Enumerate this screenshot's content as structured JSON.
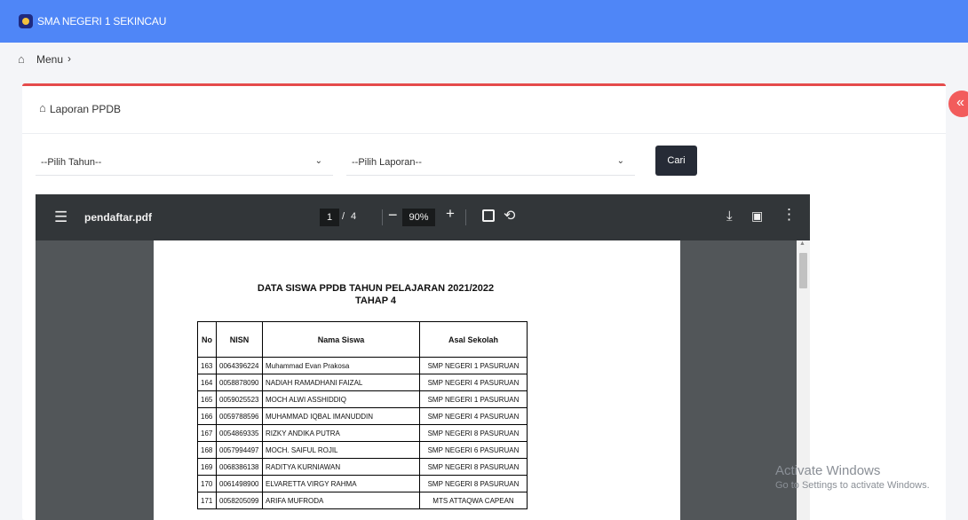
{
  "topbar": {
    "school_name": "SMA NEGERI 1 SEKINCAU"
  },
  "breadcrumb": {
    "home_icon": "home-icon",
    "menu_label": "Menu",
    "separator": "›"
  },
  "collapse_button": {
    "icon": "double-chevron-left-icon",
    "glyph": "«"
  },
  "card": {
    "title": "Laporan PPDB"
  },
  "filters": {
    "year_select": "--Pilih Tahun--",
    "report_select": "--Pilih Laporan--",
    "search_button": "Cari"
  },
  "pdf": {
    "file_name": "pendaftar.pdf",
    "current_page": "1",
    "page_separator": "/",
    "total_pages": "4",
    "zoom": "90%",
    "document": {
      "heading": "DATA SISWA PPDB TAHUN PELAJARAN 2021/2022",
      "subheading": "TAHAP 4",
      "columns": [
        "No",
        "NISN",
        "Nama Siswa",
        "Asal Sekolah"
      ],
      "rows": [
        [
          "163",
          "0064396224",
          "Muhammad Evan Prakosa",
          "SMP NEGERI 1 PASURUAN"
        ],
        [
          "164",
          "0058878090",
          "NADIAH RAMADHANI FAIZAL",
          "SMP NEGERI 4 PASURUAN"
        ],
        [
          "165",
          "0059025523",
          "MOCH ALWI ASSHIDDIQ",
          "SMP NEGERI 1 PASURUAN"
        ],
        [
          "166",
          "0059788596",
          "MUHAMMAD IQBAL IMANUDDIN",
          "SMP NEGERI 4 PASURUAN"
        ],
        [
          "167",
          "0054869335",
          "RIZKY ANDIKA PUTRA",
          "SMP NEGERI 8 PASURUAN"
        ],
        [
          "168",
          "0057994497",
          "MOCH. SAIFUL ROJIL",
          "SMP NEGERI 6 PASURUAN"
        ],
        [
          "169",
          "0068386138",
          "RADITYA KURNIAWAN",
          "SMP NEGERI 8 PASURUAN"
        ],
        [
          "170",
          "0061498900",
          "ELVARETTA VIRGY RAHMA",
          "SMP NEGERI 8 PASURUAN"
        ],
        [
          "171",
          "0058205099",
          "ARIFA MUFRODA",
          "MTS ATTAQWA CAPEAN"
        ]
      ]
    }
  },
  "watermark": {
    "line1": "Activate Windows",
    "line2": "Go to Settings to activate Windows."
  },
  "colors": {
    "topbar": "#4f86f7",
    "card_accent": "#e54b4b",
    "button": "#262b36",
    "pdf_toolbar": "#323639",
    "pdf_background": "#525659"
  }
}
